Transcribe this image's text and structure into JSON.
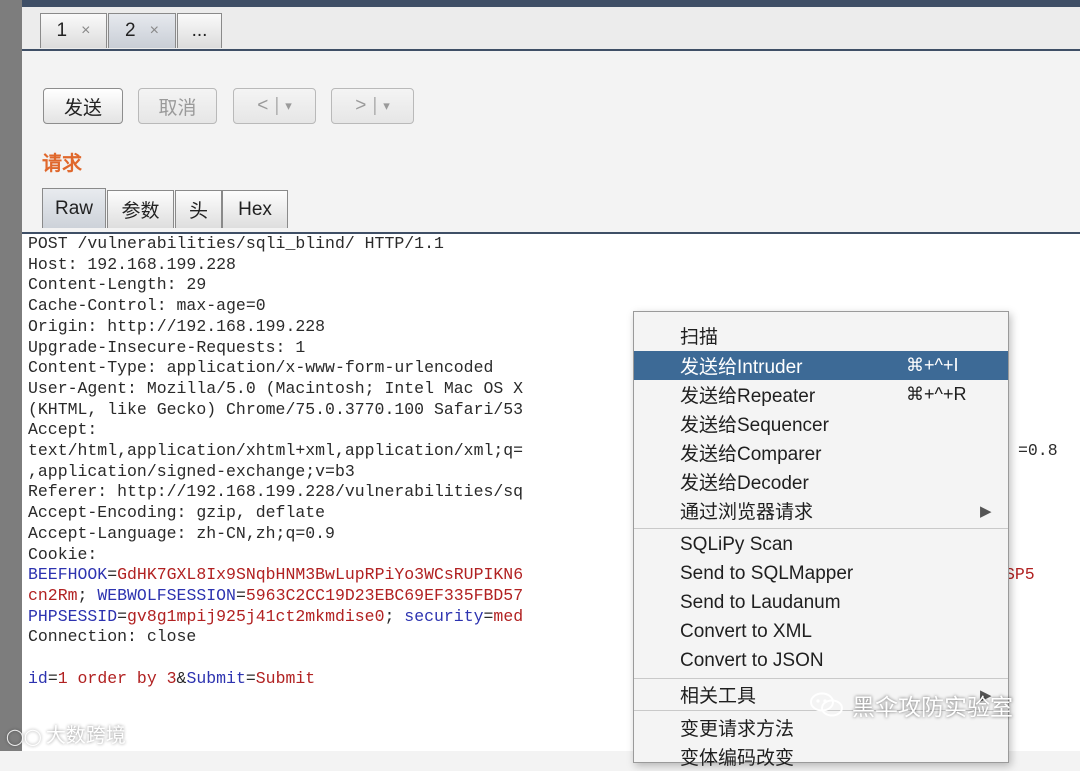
{
  "tabs": [
    {
      "label": "1",
      "close": "×"
    },
    {
      "label": "2",
      "close": "×"
    },
    {
      "label": "..."
    }
  ],
  "toolbar": {
    "send": "发送",
    "cancel": "取消",
    "back": "<",
    "forward": ">",
    "dropdown": "▾"
  },
  "request_title": "请求",
  "subtabs": [
    "Raw",
    "参数",
    "头",
    "Hex"
  ],
  "request_lines": [
    "POST /vulnerabilities/sqli_blind/ HTTP/1.1",
    "Host: 192.168.199.228",
    "Content-Length: 29",
    "Cache-Control: max-age=0",
    "Origin: http://192.168.199.228",
    "Upgrade-Insecure-Requests: 1",
    "Content-Type: application/x-www-form-urlencoded",
    "User-Agent: Mozilla/5.0 (Macintosh; Intel Mac OS X",
    "(KHTML, like Gecko) Chrome/75.0.3770.100 Safari/53",
    "Accept:",
    "text/html,application/xhtml+xml,application/xml;q=",
    ",application/signed-exchange;v=b3",
    "Referer: http://192.168.199.228/vulnerabilities/sq",
    "Accept-Encoding: gzip, deflate",
    "Accept-Language: zh-CN,zh;q=0.9",
    "Cookie:"
  ],
  "accept_tail": "=0.8",
  "cookies": {
    "beefhook_name": "BEEFHOOK",
    "beefhook_val": "GdHK7GXL8Ix9SNqbHNM3BwLupRPiYo3WCsRUPIKN6",
    "beefhook_tail": "SP5",
    "line2_val": "cn2Rm",
    "sep": "; ",
    "webwolf_name": "WEBWOLFSESSION",
    "webwolf_val": "5963C2CC19D23EBC69EF335FBD57",
    "phpsess_name": "PHPSESSID",
    "phpsess_val": "gv8g1mpij925j41ct2mkmdise0",
    "security_name": "security",
    "security_val": "med"
  },
  "connection_line": "Connection: close",
  "body": {
    "id_name": "id",
    "id_val": "1 order by 3",
    "amp": "&",
    "submit_name": "Submit",
    "submit_val": "Submit"
  },
  "context_menu": [
    {
      "label": "扫描"
    },
    {
      "label": "发送给Intruder",
      "shortcut": "⌘+^+I",
      "selected": true
    },
    {
      "label": "发送给Repeater",
      "shortcut": "⌘+^+R"
    },
    {
      "label": "发送给Sequencer"
    },
    {
      "label": "发送给Comparer"
    },
    {
      "label": "发送给Decoder"
    },
    {
      "label": "通过浏览器请求",
      "arrow": "▶"
    },
    {
      "label": "SQLiPy Scan"
    },
    {
      "label": "Send to SQLMapper"
    },
    {
      "label": "Send to Laudanum"
    },
    {
      "label": "Convert to XML"
    },
    {
      "label": "Convert to JSON"
    },
    {
      "label": "相关工具",
      "arrow": "▶"
    },
    {
      "label": "变更请求方法"
    },
    {
      "label": "变体编码改变"
    }
  ],
  "watermarks": {
    "left": "大数跨境",
    "right": "黑伞攻防实验室"
  },
  "colors": {
    "header_band": "#3f4f66",
    "title_orange": "#e0682c",
    "menu_highlight": "#3d6a96",
    "cookie_name": "#2d33b0",
    "cookie_value": "#b12121"
  }
}
